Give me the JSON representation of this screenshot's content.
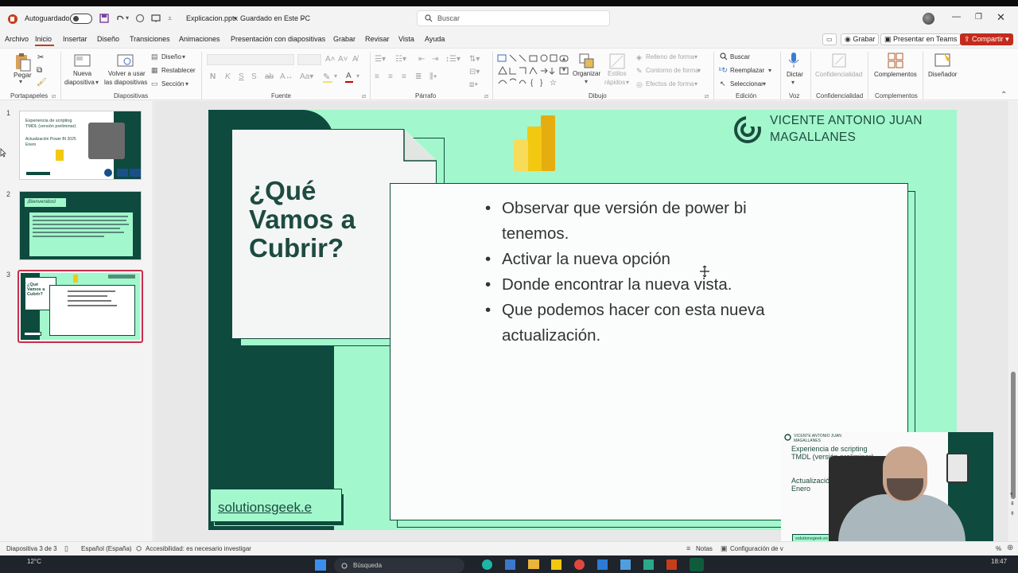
{
  "titlebar": {
    "autosave_label": "Autoguardado",
    "file_name": "Explicacion.pptx",
    "separator": "•",
    "save_status": "Guardado en Este PC",
    "search_placeholder": "Buscar"
  },
  "menu_tabs": [
    "Archivo",
    "Inicio",
    "Insertar",
    "Diseño",
    "Transiciones",
    "Animaciones",
    "Presentación con diapositivas",
    "Grabar",
    "Revisar",
    "Vista",
    "Ayuda"
  ],
  "active_tab": "Inicio",
  "top_buttons": {
    "record": "Grabar",
    "present_teams": "Presentar en Teams",
    "share": "Compartir"
  },
  "ribbon": {
    "clipboard": {
      "paste": "Pegar",
      "group": "Portapapeles"
    },
    "slides": {
      "new_slide_l1": "Nueva",
      "new_slide_l2": "diapositiva",
      "reuse_l1": "Volver a usar",
      "reuse_l2": "las diapositivas",
      "layout": "Diseño",
      "reset": "Restablecer",
      "section": "Sección",
      "group": "Diapositivas"
    },
    "font": {
      "bold": "N",
      "italic": "K",
      "underline": "S",
      "strike": "S",
      "group": "Fuente"
    },
    "paragraph": {
      "group": "Párrafo"
    },
    "drawing": {
      "arrange": "Organizar",
      "quick_l1": "Estilos",
      "quick_l2": "rápidos",
      "fill": "Relleno de forma",
      "outline": "Contorno de forma",
      "effects": "Efectos de forma",
      "group": "Dibujo"
    },
    "editing": {
      "find": "Buscar",
      "replace": "Reemplazar",
      "select": "Seleccionar",
      "group": "Edición"
    },
    "voice": {
      "dictate": "Dictar",
      "group": "Voz"
    },
    "confidentiality": {
      "label": "Confidencialidad",
      "group": "Confidencialidad"
    },
    "addins": {
      "label": "Complementos",
      "group": "Complementos"
    },
    "designer": {
      "label": "Diseñador"
    }
  },
  "thumbnails": [
    {
      "number": "1",
      "line1": "Experiencia de scripting",
      "line2": "TMDL (versión preliminar)",
      "line3": "Actualización Power BI 2025",
      "line4": "Enero"
    },
    {
      "number": "2",
      "title": "¡Bienvenidos!"
    },
    {
      "number": "3",
      "title": "¿Qué Vamos a Cubrir?"
    }
  ],
  "slide": {
    "heading_l1": "¿Qué",
    "heading_l2": "Vamos a",
    "heading_l3": "Cubrir?",
    "author_l1": "VICENTE ANTONIO JUAN",
    "author_l2": "MAGALLANES",
    "bullets": [
      {
        "l1": "Observar que versión de power bi",
        "l2": "tenemos."
      },
      {
        "l1": "Activar la nueva opción",
        "l2": ""
      },
      {
        "l1": "Donde encontrar la nueva vista.",
        "l2": ""
      },
      {
        "l1": "Que podemos hacer con esta nueva",
        "l2": "actualización."
      }
    ],
    "website": "solutionsgeek.e"
  },
  "webcam_overlay": {
    "author_l1": "VICENTE ANTONIO JUAN",
    "author_l2": "MAGALLANES",
    "line1": "Experiencia de scripting",
    "line2": "TMDL (versión preliminar)",
    "line3": "Actualización Power B",
    "line4": "Enero",
    "site": "solutionsgeek.es"
  },
  "statusbar": {
    "slide_info": "Diapositiva 3 de 3",
    "language": "Español (España)",
    "accessibility": "Accesibilidad: es necesario investigar",
    "notes": "Notas",
    "view_settings": "Configuración de v",
    "zoom_suffix": "%"
  },
  "taskbar": {
    "temperature": "12°C",
    "search_placeholder": "Búsqueda",
    "time": "18:47"
  },
  "colors": {
    "slide_mint": "#a3f7cc",
    "slide_dark": "#0e4a3e",
    "slide_text": "#1d4b40",
    "share_red": "#c42b1c"
  }
}
